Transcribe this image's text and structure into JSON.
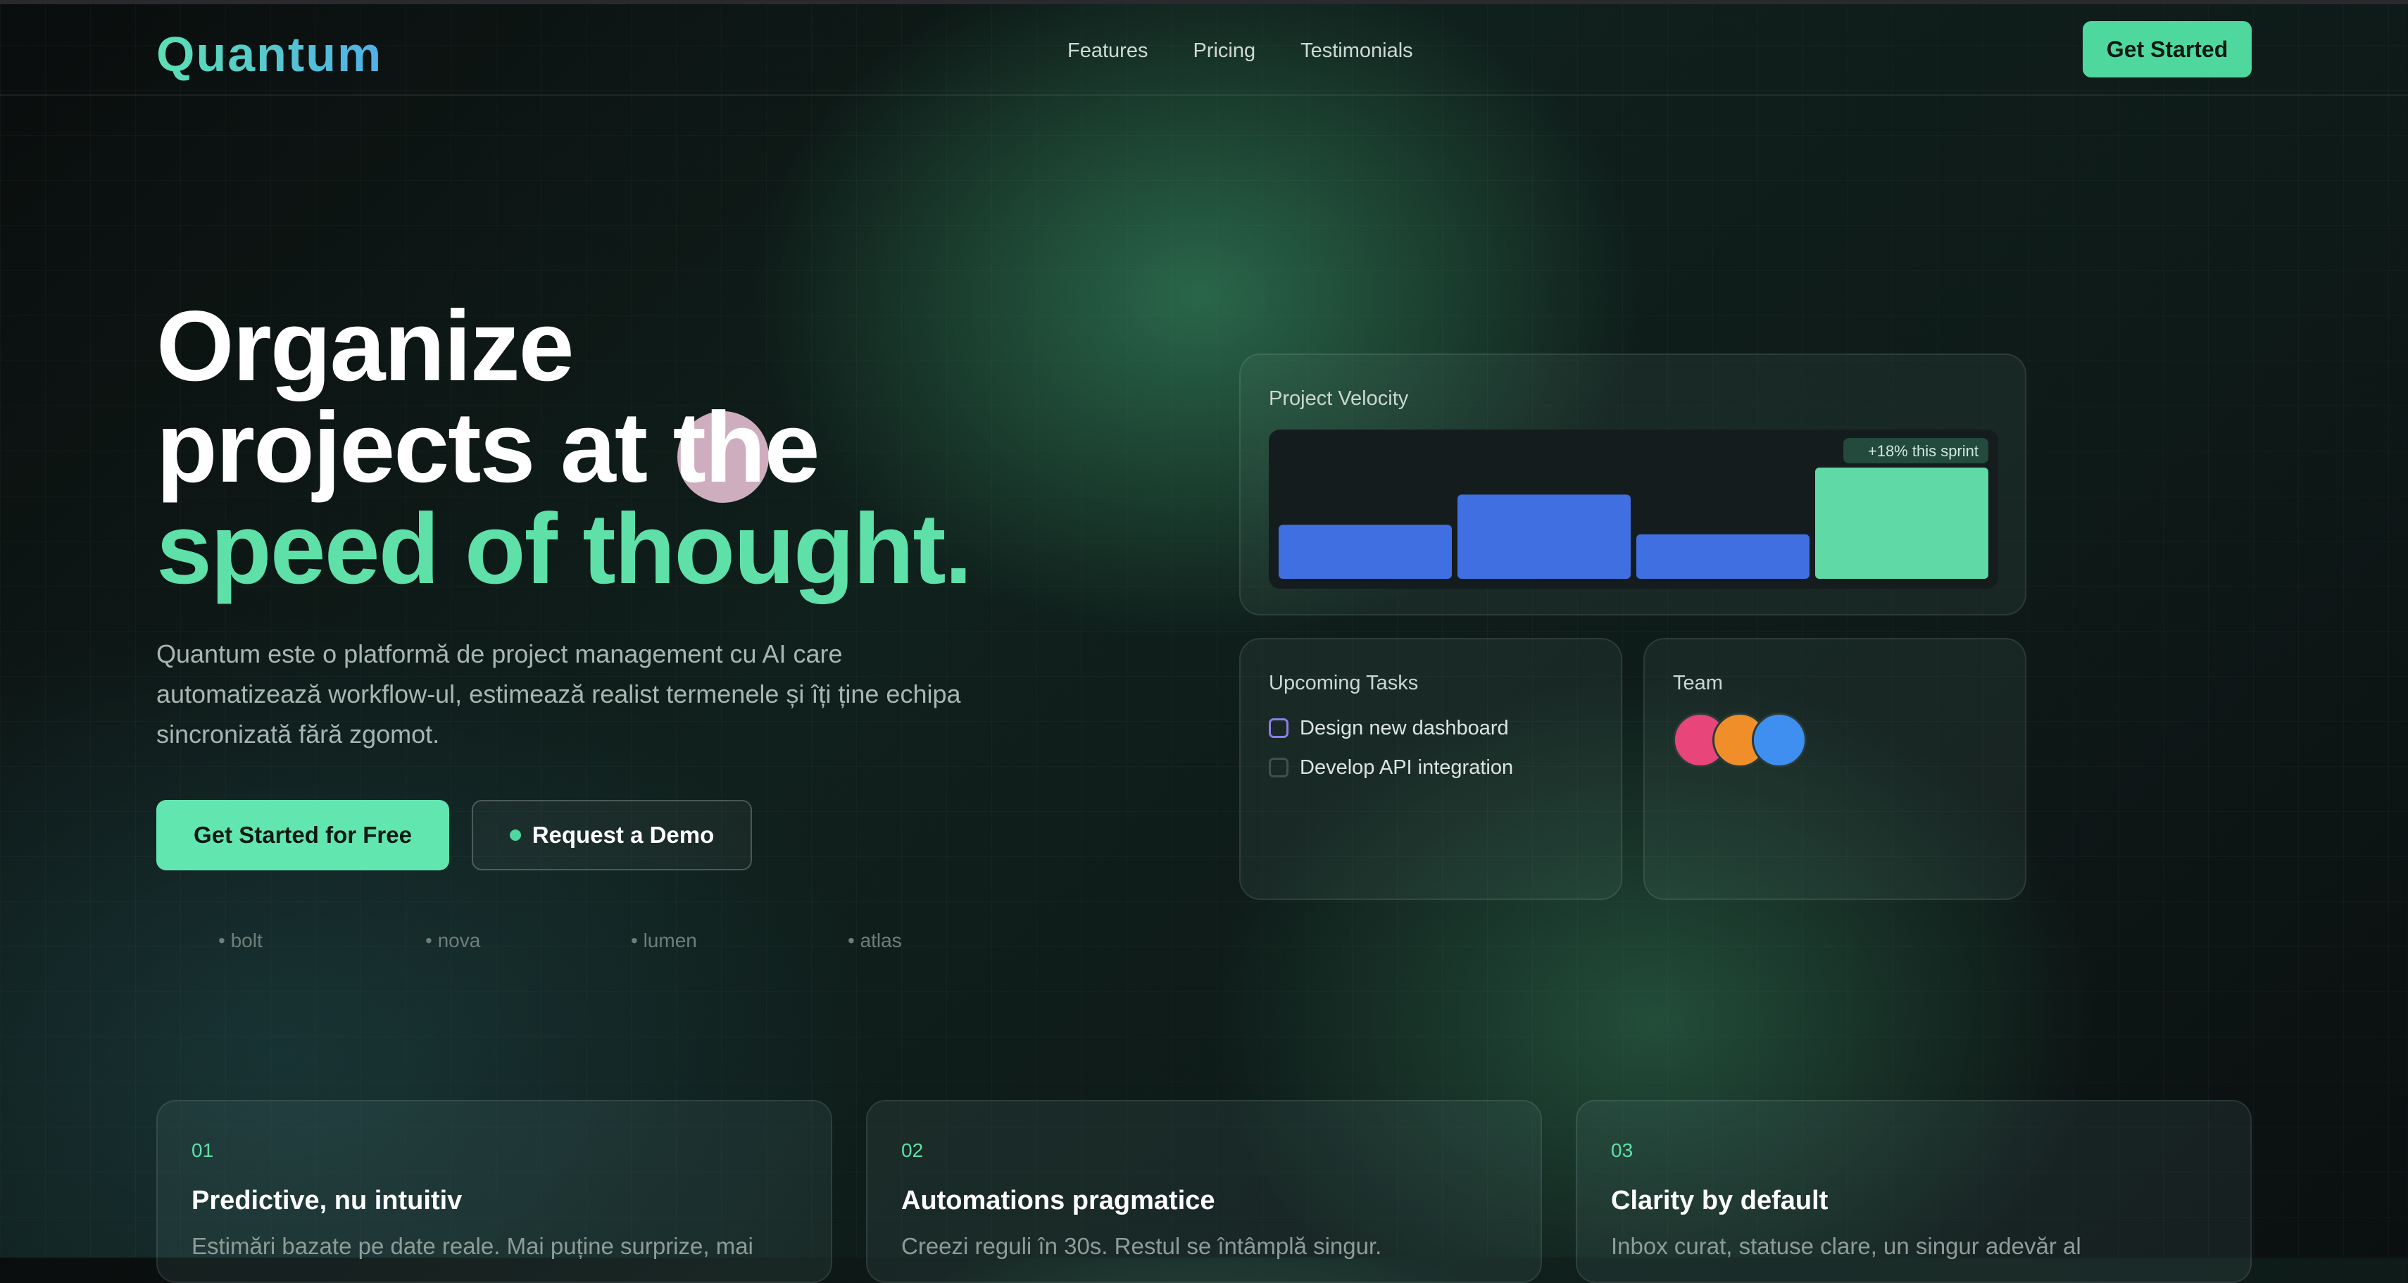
{
  "brand": {
    "name": "Quantum"
  },
  "nav": {
    "links": [
      "Features",
      "Pricing",
      "Testimonials"
    ],
    "cta": "Get Started"
  },
  "hero": {
    "title_line1": "Organize",
    "title_line2": "projects at the",
    "title_line3": "speed of thought.",
    "description": "Quantum este o platformă de project management cu AI care automatizează workflow-ul, estimează realist termenele și îți ține echipa sincronizată fără zgomot.",
    "primary_cta": "Get Started for Free",
    "secondary_cta": "Request a Demo",
    "logos": [
      "• bolt",
      "• nova",
      "• lumen",
      "• atlas"
    ]
  },
  "velocity_card": {
    "label": "Project Velocity",
    "badge": "+18% this sprint",
    "bars": [
      {
        "value": 0.34,
        "color": "#3f6fe0"
      },
      {
        "value": 0.53,
        "color": "#3f6fe0"
      },
      {
        "value": 0.28,
        "color": "#3f6fe0"
      },
      {
        "value": 0.7,
        "color": "#5fd9a6"
      }
    ]
  },
  "tasks_card": {
    "label": "Upcoming Tasks",
    "items": [
      {
        "text": "Design new dashboard",
        "active": true
      },
      {
        "text": "Develop API integration",
        "active": false
      }
    ]
  },
  "team_card": {
    "label": "Team",
    "avatar_colors": [
      "#e8457a",
      "#f08f2a",
      "#3e8ff0"
    ]
  },
  "features": [
    {
      "num": "01",
      "title": "Predictive, nu intuitiv",
      "desc": "Estimări bazate pe date reale. Mai puține surprize, mai"
    },
    {
      "num": "02",
      "title": "Automations pragmatice",
      "desc": "Creezi reguli în 30s. Restul se întâmplă singur."
    },
    {
      "num": "03",
      "title": "Clarity by default",
      "desc": "Inbox curat, statuse clare, un singur adevăr al"
    }
  ],
  "colors": {
    "accent": "#5ee0a8",
    "bar_blue": "#3f6fe0",
    "bar_green": "#5fd9a6",
    "checkbox": "#8b7fe6",
    "cursor_highlight": "#f0c8dc"
  }
}
